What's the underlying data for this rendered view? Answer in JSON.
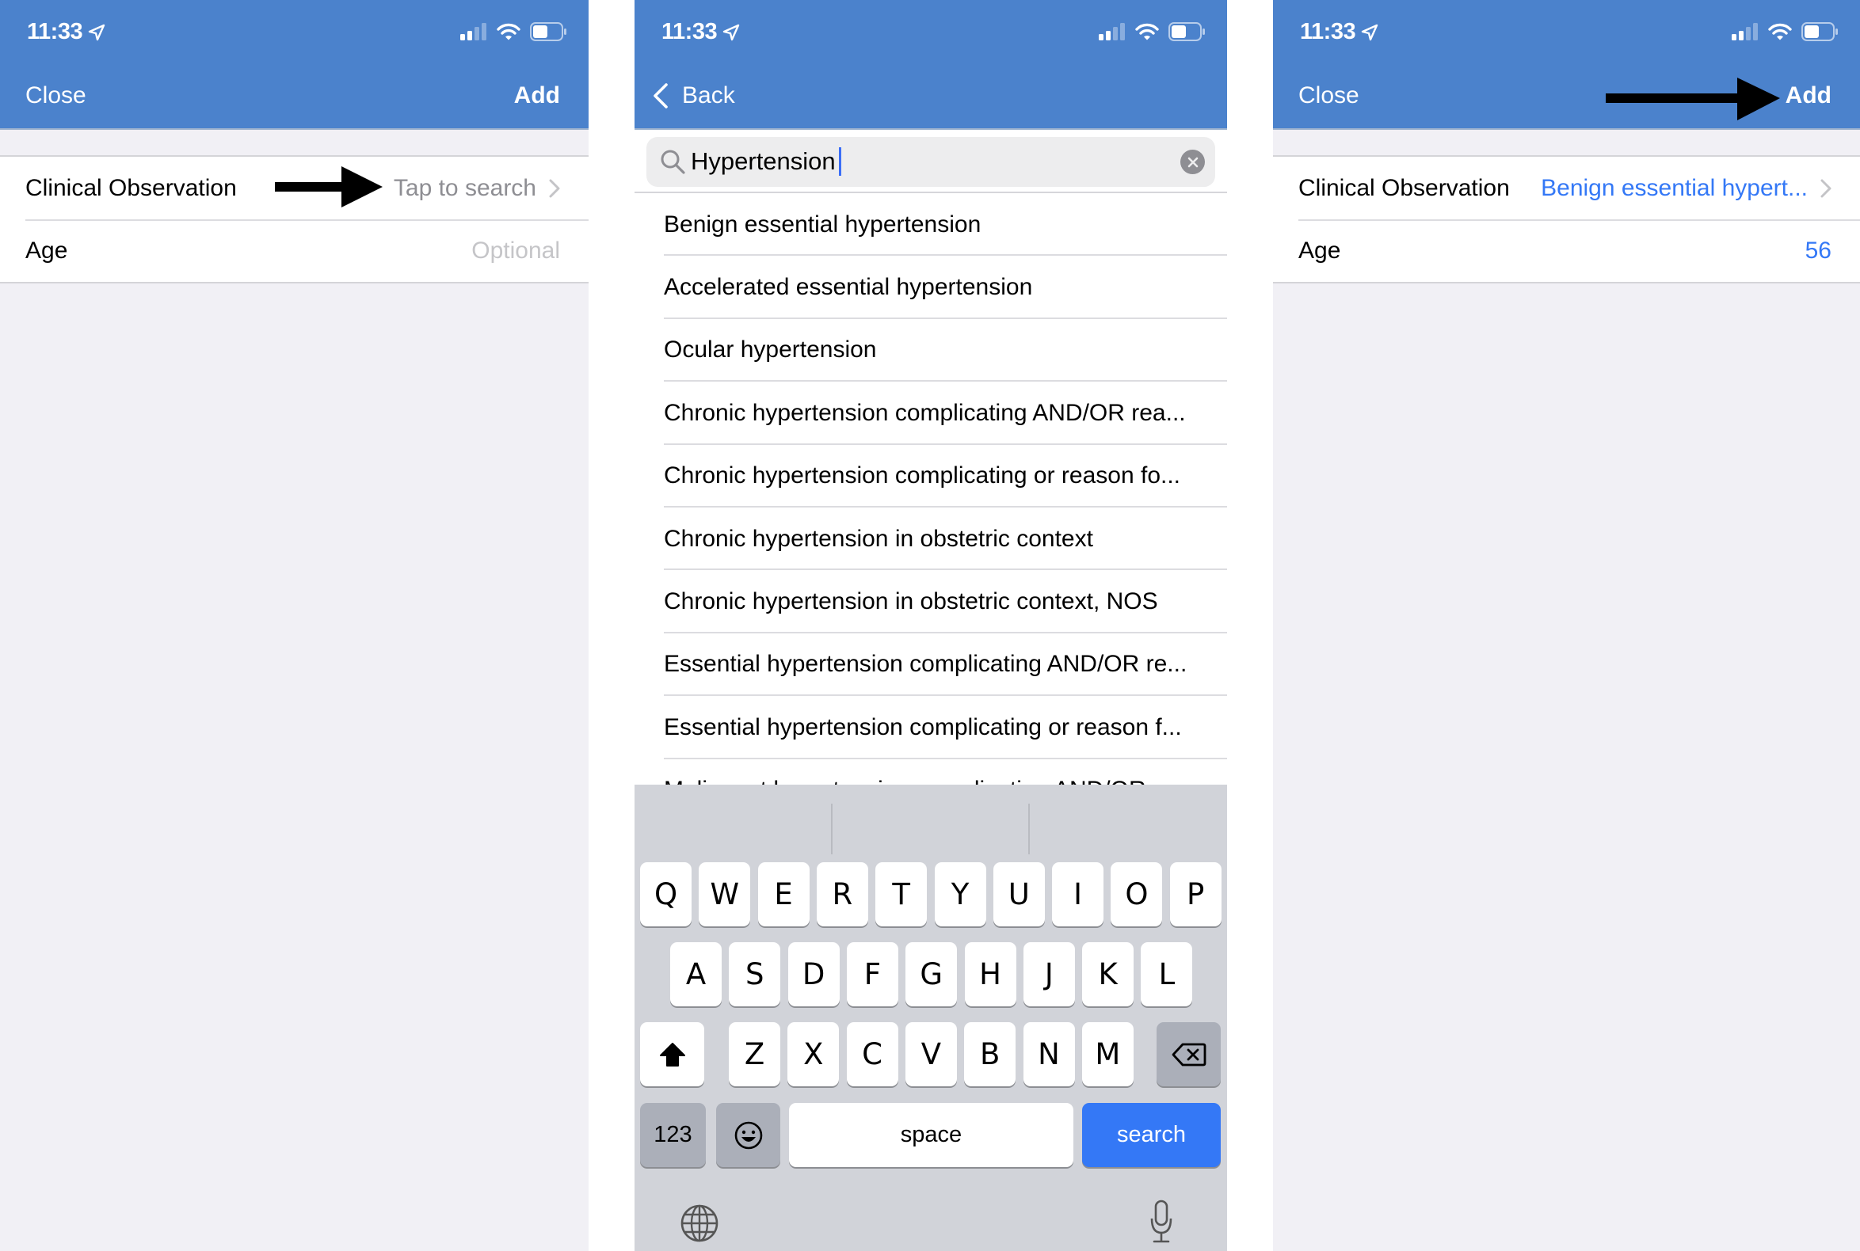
{
  "status_bar": {
    "time": "11:33",
    "signal_bars_filled": 2,
    "signal_bars_total": 4,
    "battery_level": 0.5
  },
  "colors": {
    "nav_bar": "#4B82CC",
    "accent_blue": "#3478F6",
    "grouped_background": "#F1F0F5",
    "keyboard_background": "#D1D3D9"
  },
  "screen1": {
    "nav": {
      "left_button": "Close",
      "right_button": "Add"
    },
    "rows": [
      {
        "label": "Clinical Observation",
        "value": "Tap to search",
        "has_chevron": true
      },
      {
        "label": "Age",
        "value": "Optional",
        "has_chevron": false
      }
    ],
    "annotation": "arrow-pointing-to-tap-to-search"
  },
  "screen2": {
    "nav": {
      "back_button": "Back"
    },
    "search": {
      "value": "Hypertension",
      "placeholder": ""
    },
    "results": [
      "Benign essential hypertension",
      "Accelerated essential hypertension",
      "Ocular hypertension",
      "Chronic hypertension complicating AND/OR rea...",
      "Chronic hypertension complicating or reason fo...",
      "Chronic hypertension in obstetric context",
      "Chronic hypertension in obstetric context, NOS",
      "Essential hypertension complicating AND/OR re...",
      "Essential hypertension complicating or reason f...",
      "Malignant hypertension complicating AND/OR..."
    ],
    "keyboard": {
      "row1": [
        "Q",
        "W",
        "E",
        "R",
        "T",
        "Y",
        "U",
        "I",
        "O",
        "P"
      ],
      "row2": [
        "A",
        "S",
        "D",
        "F",
        "G",
        "H",
        "J",
        "K",
        "L"
      ],
      "row3": [
        "Z",
        "X",
        "C",
        "V",
        "B",
        "N",
        "M"
      ],
      "numbers_key": "123",
      "space_key": "space",
      "return_key": "search"
    }
  },
  "screen3": {
    "nav": {
      "left_button": "Close",
      "right_button": "Add"
    },
    "rows": [
      {
        "label": "Clinical Observation",
        "value": "Benign essential hypert...",
        "has_chevron": true
      },
      {
        "label": "Age",
        "value": "56",
        "has_chevron": false
      }
    ],
    "annotation": "arrow-pointing-to-add-button"
  }
}
